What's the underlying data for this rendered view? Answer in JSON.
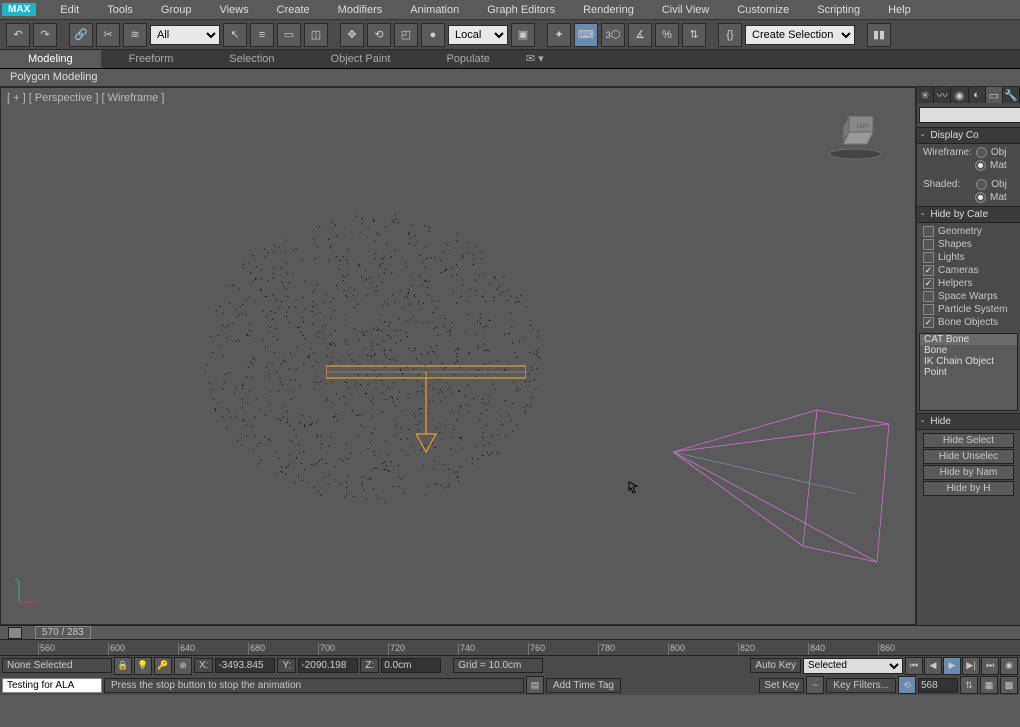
{
  "app_badge": "MAX",
  "menu": [
    "Edit",
    "Tools",
    "Group",
    "Views",
    "Create",
    "Modifiers",
    "Animation",
    "Graph Editors",
    "Rendering",
    "Civil View",
    "Customize",
    "Scripting",
    "Help"
  ],
  "toolbar": {
    "filter_all": "All",
    "coord_system": "Local",
    "create_sel_set": "Create Selection Set"
  },
  "ribbon": {
    "tabs": [
      "Modeling",
      "Freeform",
      "Selection",
      "Object Paint",
      "Populate"
    ],
    "active_tab": "Modeling",
    "sub_label": "Polygon Modeling"
  },
  "viewport": {
    "label": "[ + ] [ Perspective ] [ Wireframe ]"
  },
  "side": {
    "rollout_display": "Display Co",
    "wireframe_label": "Wireframe:",
    "shaded_label": "Shaded:",
    "opt_obj": "Obj",
    "opt_mat": "Mat",
    "rollout_hidecat": "Hide by Cate",
    "categories": [
      {
        "label": "Geometry",
        "checked": false
      },
      {
        "label": "Shapes",
        "checked": false
      },
      {
        "label": "Lights",
        "checked": false
      },
      {
        "label": "Cameras",
        "checked": true
      },
      {
        "label": "Helpers",
        "checked": true
      },
      {
        "label": "Space Warps",
        "checked": false
      },
      {
        "label": "Particle System",
        "checked": false
      },
      {
        "label": "Bone Objects",
        "checked": true
      }
    ],
    "list_items": [
      "CAT Bone",
      "Bone",
      "IK Chain Object",
      "Point"
    ],
    "rollout_hide": "Hide",
    "hide_buttons": [
      "Hide Select",
      "Hide Unselec",
      "Hide by Nam",
      "Hide by H"
    ]
  },
  "timeline": {
    "frame_display": "570 / 283",
    "ruler_marks": [
      "560",
      "600",
      "640",
      "680",
      "700",
      "720",
      "740",
      "760",
      "780",
      "800",
      "820",
      "840",
      "860"
    ]
  },
  "status": {
    "selection": "None Selected",
    "x_label": "X:",
    "x_val": "-3493.845",
    "y_label": "Y:",
    "y_val": "-2090.198",
    "z_label": "Z:",
    "z_val": "0.0cm",
    "grid": "Grid = 10.0cm",
    "autokey": "Auto Key",
    "setkey": "Set Key",
    "key_mode": "Selected",
    "key_filters": "Key Filters...",
    "frame_input": "568",
    "testing": "Testing for ALA",
    "hint": "Press the stop button to stop the animation",
    "add_time_tag": "Add Time Tag"
  }
}
